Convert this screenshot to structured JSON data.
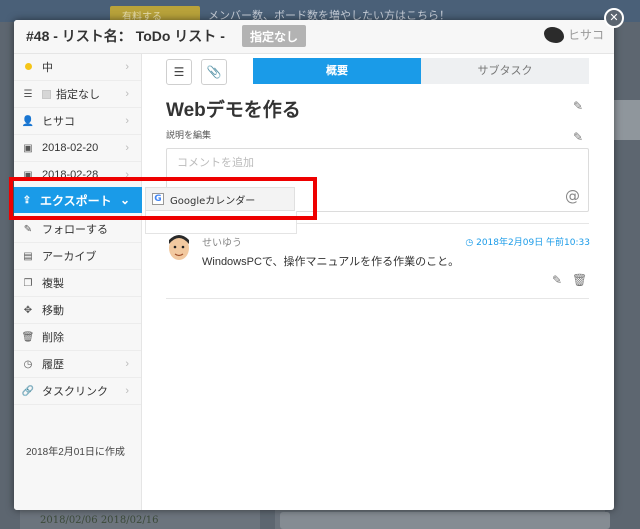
{
  "background": {
    "upgrade_label": "有料する",
    "notice": "メンバー数、ボード数を増やしたい方はこちら！",
    "bottom_text": "2018/02/06  2018/02/16"
  },
  "header": {
    "title": "#48 - リスト名： ToDo リスト -",
    "label_tag": "指定なし",
    "assignee": "ヒサコ"
  },
  "sidebar": {
    "items": [
      {
        "label": "中",
        "icon": "priority-dot-icon",
        "chevron": true
      },
      {
        "label": "指定なし",
        "icon": "label-list-icon",
        "chevron": true
      },
      {
        "label": "ヒサコ",
        "icon": "user-icon",
        "chevron": true
      },
      {
        "label": "2018-02-20",
        "icon": "calendar-start-icon",
        "chevron": true
      },
      {
        "label": "2018-02-28",
        "icon": "calendar-due-icon",
        "chevron": true
      },
      {
        "label": "エクスポート",
        "icon": "export-icon",
        "chevron": true
      },
      {
        "label": "フォローする",
        "icon": "follow-icon",
        "chevron": false
      },
      {
        "label": "アーカイブ",
        "icon": "archive-icon",
        "chevron": false
      },
      {
        "label": "複製",
        "icon": "copy-icon",
        "chevron": false
      },
      {
        "label": "移動",
        "icon": "move-icon",
        "chevron": false
      },
      {
        "label": "削除",
        "icon": "trash-icon",
        "chevron": false
      },
      {
        "label": "履歴",
        "icon": "history-icon",
        "chevron": true
      },
      {
        "label": "タスクリンク",
        "icon": "link-icon",
        "chevron": true
      }
    ],
    "created": "2018年2月01日に作成"
  },
  "export_menu": {
    "label": "エクスポート",
    "submenu_item": "Googleカレンダー"
  },
  "main": {
    "tabs": [
      {
        "label": "概要",
        "active": true
      },
      {
        "label": "サブタスク",
        "active": false
      }
    ],
    "task_title": "Webデモを作る",
    "desc_link": "説明を編集",
    "comment_placeholder": "コメントを追加",
    "comment": {
      "author": "せいゆう",
      "time": "2018年2月09日 午前10:33",
      "text": "WindowsPCで、操作マニュアルを作る作業のこと。"
    }
  },
  "colors": {
    "accent": "#1a9be8",
    "highlight": "#ee0000"
  }
}
